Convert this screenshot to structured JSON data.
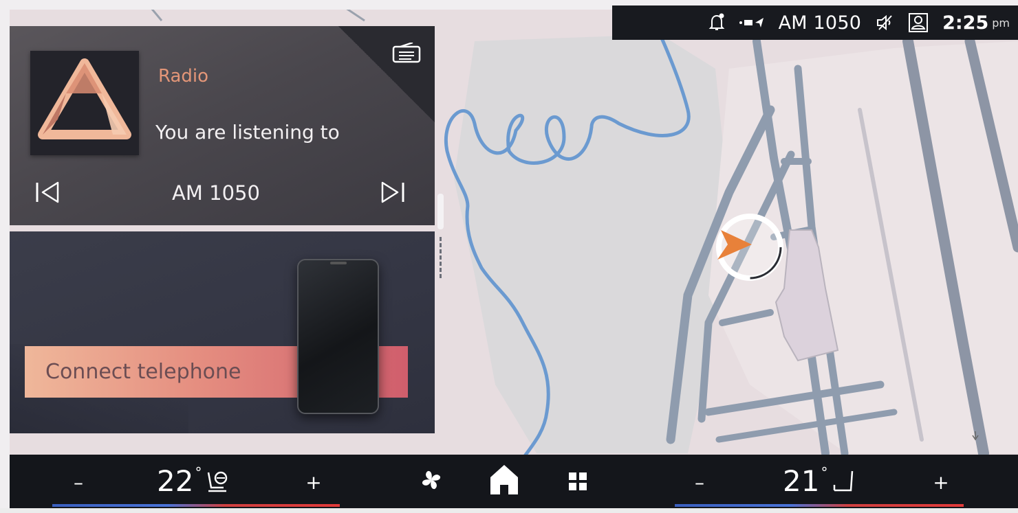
{
  "status_bar": {
    "station": "AM 1050",
    "time": "2:25",
    "ampm": "pm",
    "icons": [
      "notification-bell-icon",
      "media-source-icon",
      "muted-microphone-icon",
      "driver-profile-icon"
    ]
  },
  "radio_widget": {
    "source": "Radio",
    "subtitle": "You are listening to",
    "station": "AM 1050",
    "icons": [
      "radio-menu-icon",
      "previous-track-icon",
      "next-track-icon",
      "radio-logo-icon"
    ]
  },
  "phone_widget": {
    "connect_label": "Connect telephone"
  },
  "climate": {
    "left": {
      "minus": "–",
      "temp": "22",
      "degree": "°",
      "plus": "+",
      "icon": "heated-seat-steering-icon"
    },
    "right": {
      "minus": "–",
      "temp": "21",
      "degree": "°",
      "plus": "+",
      "icon": "seat-icon"
    },
    "center_icons": [
      "fan-icon",
      "home-icon",
      "apps-grid-icon"
    ]
  },
  "colors": {
    "accent": "#e39678",
    "river": "#6b9ad0",
    "road": "#8f9cae",
    "vehicle_arrow": "#e8813a"
  }
}
